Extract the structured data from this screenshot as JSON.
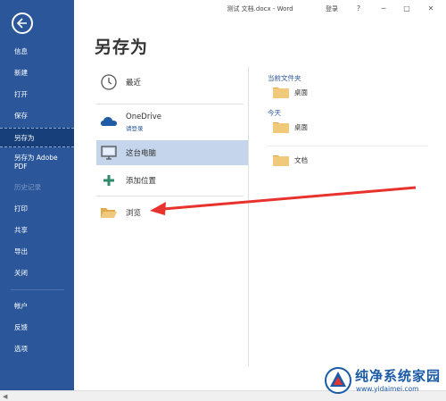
{
  "window": {
    "title": "测试 文档.docx - Word",
    "login": "登录",
    "help": "?",
    "minimize": "─",
    "restore": "□",
    "close": "✕"
  },
  "sidebar": {
    "items": [
      {
        "label": "信息"
      },
      {
        "label": "新建"
      },
      {
        "label": "打开"
      },
      {
        "label": "保存"
      },
      {
        "label": "另存为"
      },
      {
        "label": "另存为 Adobe",
        "label2": "PDF"
      },
      {
        "label": "历史记录"
      },
      {
        "label": "打印"
      },
      {
        "label": "共享"
      },
      {
        "label": "导出"
      },
      {
        "label": "关闭"
      },
      {
        "label": "帐户"
      },
      {
        "label": "反馈"
      },
      {
        "label": "选项"
      }
    ]
  },
  "main": {
    "title": "另存为",
    "places": [
      {
        "label": "最近"
      },
      {
        "label": "OneDrive",
        "sublabel": "请登录"
      },
      {
        "label": "这台电脑"
      },
      {
        "label": "添加位置"
      },
      {
        "label": "浏览"
      }
    ]
  },
  "recent": {
    "current_folder_heading": "当前文件夹",
    "current_folder": "桌面",
    "today_heading": "今天",
    "today_folder": "桌面",
    "other_folder": "文档"
  },
  "watermark": {
    "text": "纯净系统家园",
    "url": "www.yidaimei.com"
  },
  "colors": {
    "sidebar": "#2b579a",
    "selected_place": "#c5d5ec",
    "arrow": "#e8322e",
    "folder": "#f1c97a"
  }
}
